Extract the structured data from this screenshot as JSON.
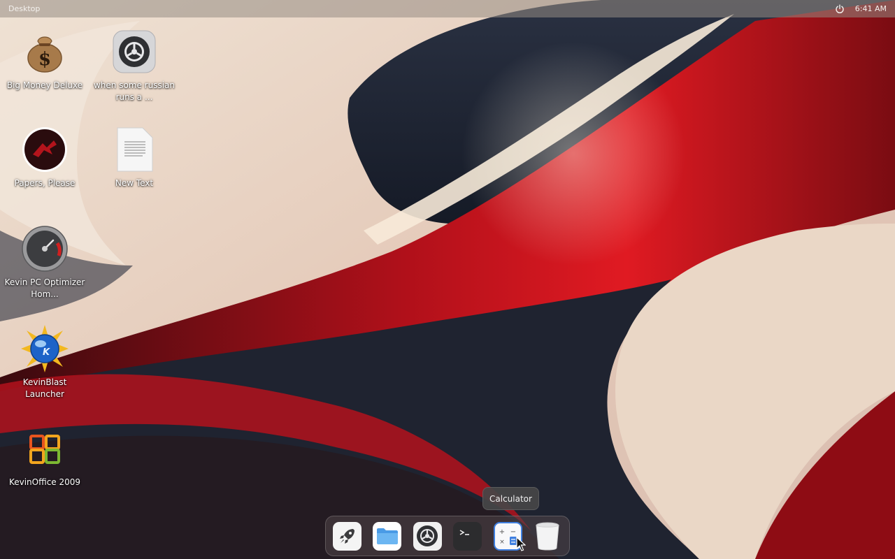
{
  "topbar": {
    "title": "Desktop",
    "clock": "6:41 AM",
    "power_icon": "power-icon"
  },
  "desktop": {
    "icons": [
      {
        "id": "big-money",
        "label": "Big Money Deluxe",
        "icon": "money-bag-icon"
      },
      {
        "id": "russian",
        "label": "when some russian runs a ...",
        "icon": "gear-icon"
      },
      {
        "id": "papers",
        "label": "Papers, Please",
        "icon": "papers-please-icon"
      },
      {
        "id": "new-text",
        "label": "New Text",
        "icon": "text-file-icon"
      },
      {
        "id": "kevin-pc",
        "label": "Kevin PC Optimizer Hom...",
        "icon": "gauge-icon"
      },
      {
        "id": "kevinblast",
        "label": "KevinBlast Launcher",
        "icon": "globe-burst-icon"
      },
      {
        "id": "kevinoffice",
        "label": "KevinOffice 2009",
        "icon": "office-icon"
      }
    ]
  },
  "tooltip": {
    "text": "Calculator"
  },
  "dock": {
    "items": [
      {
        "name": "launcher",
        "icon": "rocket-icon"
      },
      {
        "name": "files",
        "icon": "folder-icon"
      },
      {
        "name": "settings",
        "icon": "gear-icon"
      },
      {
        "name": "terminal",
        "icon": "terminal-icon"
      },
      {
        "name": "calculator",
        "icon": "calculator-icon"
      },
      {
        "name": "trash",
        "icon": "trash-icon"
      }
    ]
  },
  "colors": {
    "wallpaper_cream": "#e9d6c6",
    "wallpaper_red": "#c41018",
    "wallpaper_navy": "#1c2436"
  }
}
